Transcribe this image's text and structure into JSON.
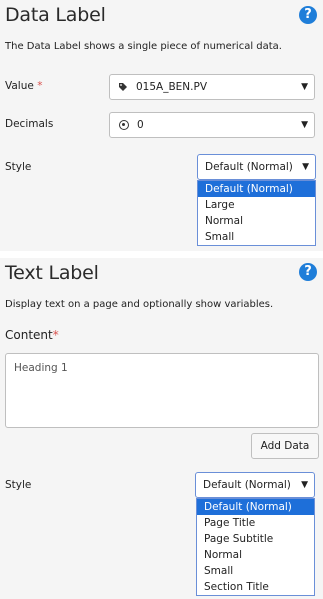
{
  "data_label": {
    "title": "Data Label",
    "help_icon": "?",
    "description": "The Data Label shows a single piece of numerical data.",
    "value": {
      "label": "Value",
      "required_mark": "*",
      "selected": "015A_BEN.PV",
      "icon": "tag-icon"
    },
    "decimals": {
      "label": "Decimals",
      "selected": "0",
      "icon": "radio-dot-icon"
    },
    "style": {
      "label": "Style",
      "selected": "Default (Normal)",
      "options": [
        "Default (Normal)",
        "Large",
        "Normal",
        "Small"
      ]
    }
  },
  "text_label": {
    "title": "Text Label",
    "help_icon": "?",
    "description": "Display text on a page and optionally show variables.",
    "content": {
      "label": "Content",
      "required_mark": "*",
      "value": "Heading 1"
    },
    "add_data_button": "Add Data",
    "style": {
      "label": "Style",
      "selected": "Default (Normal)",
      "options": [
        "Default (Normal)",
        "Page Title",
        "Page Subtitle",
        "Normal",
        "Small",
        "Section Title"
      ]
    }
  },
  "caret_glyph": "▼",
  "colors": {
    "accent": "#1e6fd9",
    "required": "#d9534f",
    "help": "#1f7ed9"
  }
}
